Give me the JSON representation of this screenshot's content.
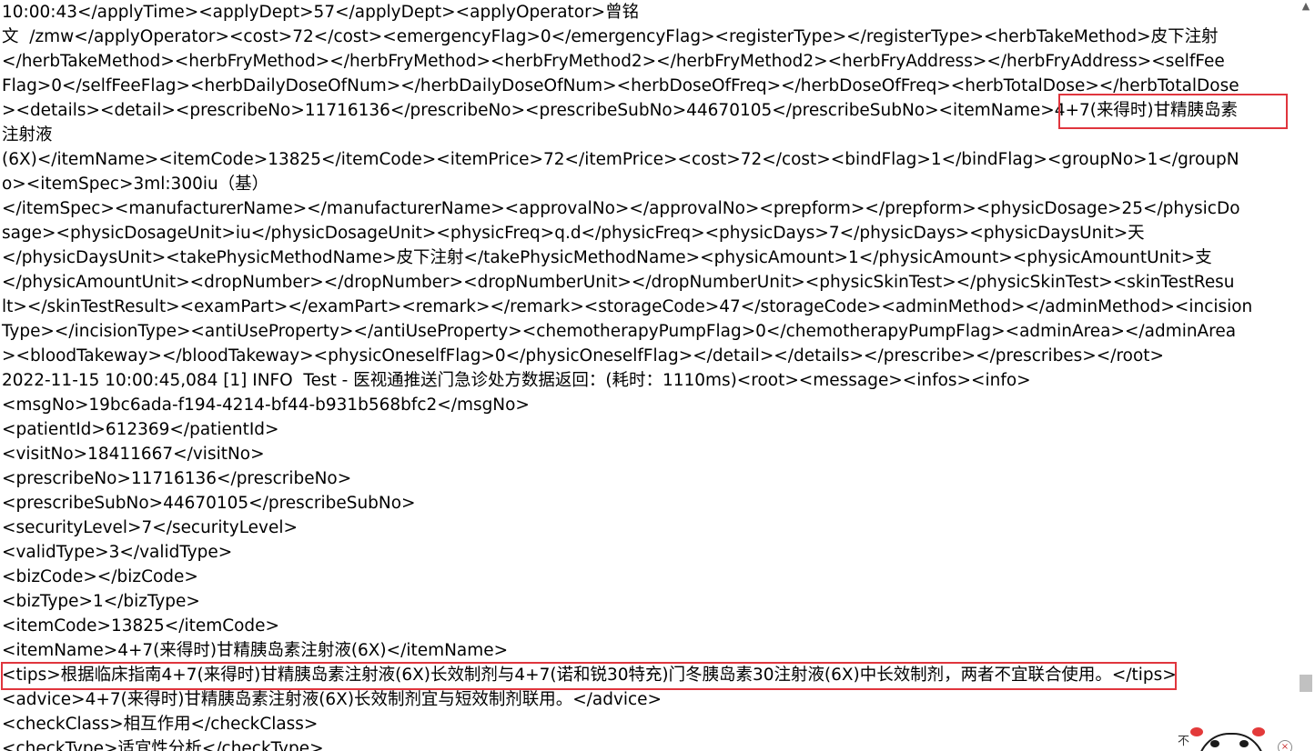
{
  "log": {
    "lines": [
      "10:00:43</applyTime><applyDept>57</applyDept><applyOperator>曾铭",
      "文  /zmw</applyOperator><cost>72</cost><emergencyFlag>0</emergencyFlag><registerType></registerType><herbTakeMethod>皮下注射",
      "</herbTakeMethod><herbFryMethod></herbFryMethod><herbFryMethod2></herbFryMethod2><herbFryAddress></herbFryAddress><selfFee",
      "Flag>0</selfFeeFlag><herbDailyDoseOfNum></herbDailyDoseOfNum><herbDoseOfFreq></herbDoseOfFreq><herbTotalDose></herbTotalDose",
      "><details><detail><prescribeNo>11716136</prescribeNo><prescribeSubNo>44670105</prescribeSubNo><itemName>4+7(来得时)甘精胰岛素",
      "注射液",
      "(6X)</itemName><itemCode>13825</itemCode><itemPrice>72</itemPrice><cost>72</cost><bindFlag>1</bindFlag><groupNo>1</groupN",
      "o><itemSpec>3ml:300iu（基）",
      "</itemSpec><manufacturerName></manufacturerName><approvalNo></approvalNo><prepform></prepform><physicDosage>25</physicDo",
      "sage><physicDosageUnit>iu</physicDosageUnit><physicFreq>q.d</physicFreq><physicDays>7</physicDays><physicDaysUnit>天",
      "</physicDaysUnit><takePhysicMethodName>皮下注射</takePhysicMethodName><physicAmount>1</physicAmount><physicAmountUnit>支",
      "</physicAmountUnit><dropNumber></dropNumber><dropNumberUnit></dropNumberUnit><physicSkinTest></physicSkinTest><skinTestResu",
      "lt></skinTestResult><examPart></examPart><remark></remark><storageCode>47</storageCode><adminMethod></adminMethod><incision",
      "Type></incisionType><antiUseProperty></antiUseProperty><chemotherapyPumpFlag>0</chemotherapyPumpFlag><adminArea></adminArea",
      "><bloodTakeway></bloodTakeway><physicOneselfFlag>0</physicOneselfFlag></detail></details></prescribe></prescribes></root>",
      "2022-11-15 10:00:45,084 [1] INFO  Test - 医视通推送门急诊处方数据返回：(耗时：1110ms)<root><message><infos><info>",
      "<msgNo>19bc6ada-f194-4214-bf44-b931b568bfc2</msgNo>",
      "<patientId>612369</patientId>",
      "<visitNo>18411667</visitNo>",
      "<prescribeNo>11716136</prescribeNo>",
      "<prescribeSubNo>44670105</prescribeSubNo>",
      "<securityLevel>7</securityLevel>",
      "<validType>3</validType>",
      "<bizCode></bizCode>",
      "<bizType>1</bizType>",
      "<itemCode>13825</itemCode>",
      "<itemName>4+7(来得时)甘精胰岛素注射液(6X)</itemName>",
      "<tips>根据临床指南4+7(来得时)甘精胰岛素注射液(6X)长效制剂与4+7(诺和锐30特充)门冬胰岛素30注射液(6X)中长效制剂，两者不宜联合使用。</tips>",
      "<advice>4+7(来得时)甘精胰岛素注射液(6X)长效制剂宜与短效制剂联用。</advice>",
      "<checkClass>相互作用</checkClass>",
      "<checkType>适宜性分析</checkType>"
    ]
  },
  "widget": {
    "label": "不"
  },
  "scrollbar": {
    "up_arrow": "▲",
    "position": 0.91
  },
  "highlight_color": "#e0353d"
}
